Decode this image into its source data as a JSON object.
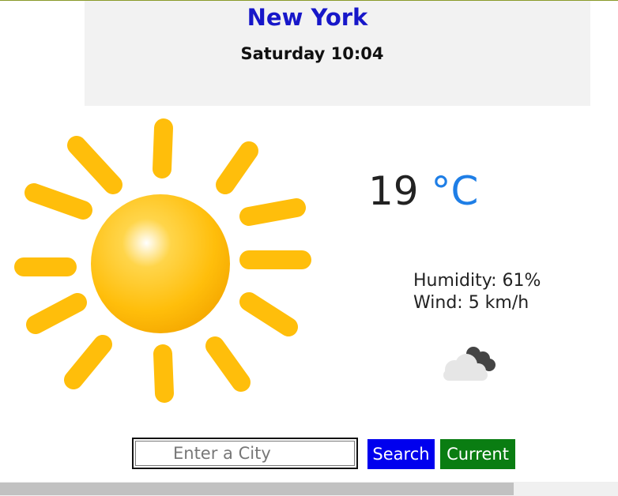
{
  "header": {
    "city": "New York",
    "datetime": "Saturday 10:04"
  },
  "weather": {
    "main_icon": "sun-icon",
    "temperature": "19",
    "unit": "°C",
    "humidity": "Humidity: 61%",
    "wind": "Wind: 5 km/h",
    "secondary_icon": "cloud-icon"
  },
  "search": {
    "placeholder": "Enter a City",
    "value": "",
    "search_label": "Search",
    "current_label": "Current"
  },
  "colors": {
    "city": "#1717c9",
    "unit": "#1e7ee6",
    "search_button": "#0000ee",
    "current_button": "#0a7d12",
    "sun": "#ffbe0b"
  }
}
